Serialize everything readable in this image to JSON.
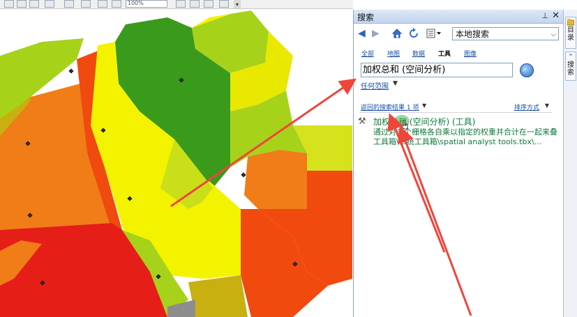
{
  "toolbar": {
    "zoom_value": "100%",
    "overflow_caret": "▾"
  },
  "map": {
    "colors": {
      "dark_green": "#3a9a1c",
      "light_green": "#a7d21a",
      "yellow_green": "#d6e21c",
      "yellow": "#f3f300",
      "orange": "#f07d17",
      "red_orange": "#f04a0f",
      "red": "#e61e18",
      "olive": "#c8b010",
      "grey": "#8d8d8d"
    }
  },
  "search_panel": {
    "title": "搜索",
    "pin_icon": "⊥",
    "close_icon": "✕",
    "location_value": "本地搜索",
    "tabs": [
      {
        "label": "全部"
      },
      {
        "label": "地图"
      },
      {
        "label": "数据"
      },
      {
        "label": "工具"
      },
      {
        "label": "图像"
      }
    ],
    "query_value": "加权总和 (空间分析)",
    "scope_label": "任何范围",
    "results_count": "返回的搜索结果 1 项",
    "sort_label": "排序方式",
    "result": {
      "title": "加权总和 (空间分析) (工具)",
      "description": "通过对多个栅格各自乘以指定的权重并合计在一起来叠...",
      "path": "工具箱\\系统工具箱\\spatial analyst tools.tbx\\..."
    }
  },
  "side_tabs": [
    {
      "label": "目录"
    },
    {
      "label": "搜索"
    }
  ],
  "annotation_color": "#f0453a"
}
